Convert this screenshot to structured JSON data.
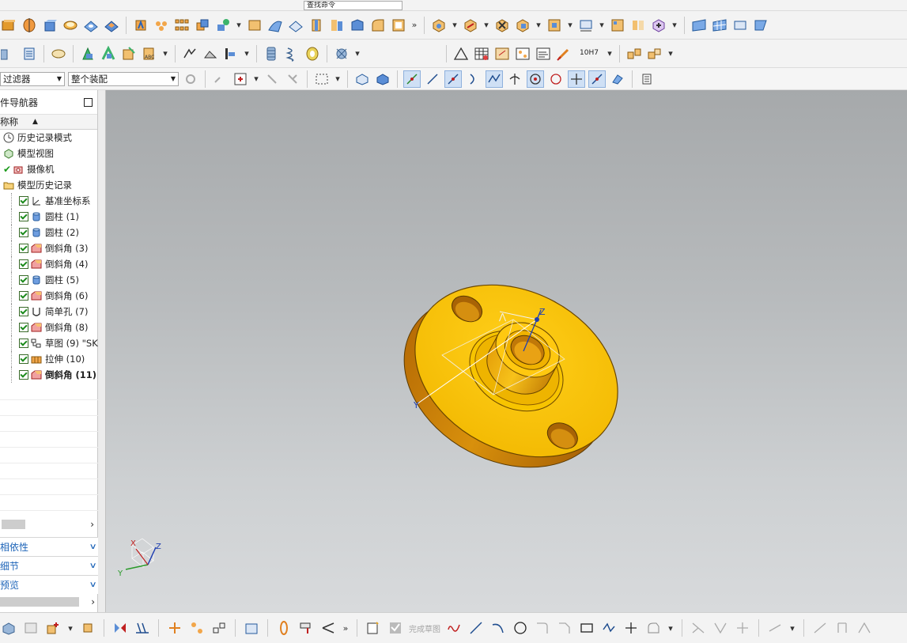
{
  "toolbar": {
    "command_search_placeholder": "查找命令",
    "filter_select": "过滤器",
    "assembly_select": "整个装配",
    "more_glyph": "»",
    "finish_sketch_label": "完成草图",
    "tolerance_label": "10H7"
  },
  "navigator": {
    "title": "件导航器",
    "column_name": "称称",
    "sort_glyph": "▲",
    "rows": [
      {
        "label": "历史记录模式",
        "icon": "clock-icon",
        "indent": 0
      },
      {
        "label": "模型视图",
        "icon": "views-icon",
        "indent": 0
      },
      {
        "label": "摄像机",
        "icon": "camera-icon",
        "indent": 0
      },
      {
        "label": "模型历史记录",
        "icon": "folder-icon",
        "indent": 0
      },
      {
        "label": "基准坐标系",
        "icon": "datum-csys-icon",
        "indent": 1
      },
      {
        "label": "圆柱 (1)",
        "icon": "cylinder-icon",
        "indent": 1
      },
      {
        "label": "圆柱 (2)",
        "icon": "cylinder-icon",
        "indent": 1
      },
      {
        "label": "倒斜角 (3)",
        "icon": "chamfer-icon",
        "indent": 1
      },
      {
        "label": "倒斜角 (4)",
        "icon": "chamfer-icon",
        "indent": 1
      },
      {
        "label": "圆柱 (5)",
        "icon": "cylinder-icon",
        "indent": 1
      },
      {
        "label": "倒斜角 (6)",
        "icon": "chamfer-icon",
        "indent": 1
      },
      {
        "label": "简单孔 (7)",
        "icon": "hole-icon",
        "indent": 1
      },
      {
        "label": "倒斜角 (8)",
        "icon": "chamfer-icon",
        "indent": 1
      },
      {
        "label": "草图 (9) \"SK",
        "icon": "sketch-icon",
        "indent": 1
      },
      {
        "label": "拉伸 (10)",
        "icon": "extrude-icon",
        "indent": 1
      },
      {
        "label": "倒斜角 (11)",
        "icon": "chamfer-icon",
        "indent": 1
      }
    ],
    "panels": [
      "相依性",
      "细节",
      "预览"
    ],
    "chevron": "∨",
    "scroll_right": "›"
  },
  "viewport": {
    "axis_x": "X",
    "axis_y": "Y",
    "axis_z": "Z",
    "model_color": "#f5c300"
  }
}
